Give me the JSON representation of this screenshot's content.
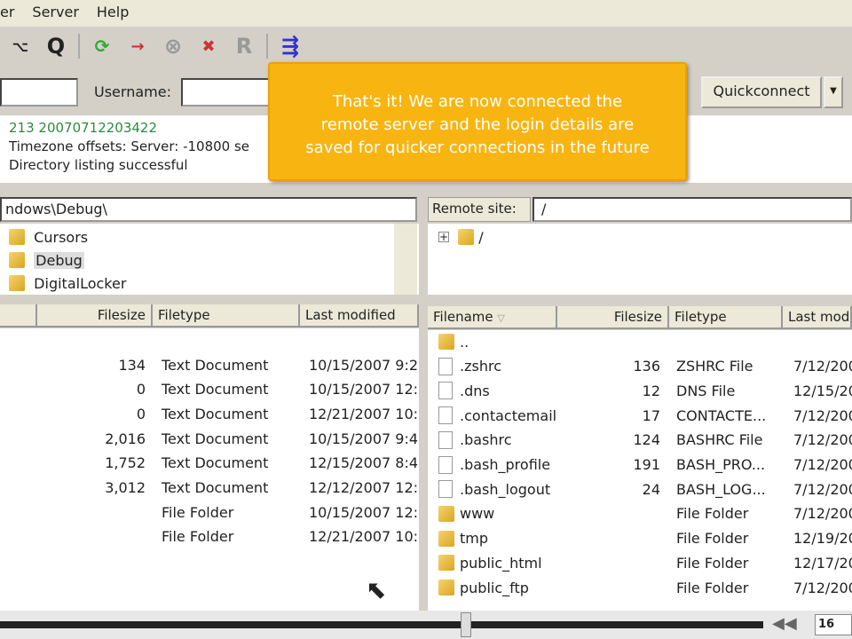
{
  "menu": [
    "er",
    "Server",
    "Help"
  ],
  "quickconnect": {
    "username_label": "Username:",
    "button": "Quickconnect"
  },
  "log": [
    {
      "text": "213 20070712203422",
      "color": "#2e8b3c"
    },
    {
      "text": "Timezone offsets: Server: -10800 se",
      "color": "#222"
    },
    {
      "text": "Directory listing successful",
      "color": "#222"
    }
  ],
  "tooltip": {
    "lines": [
      "That's it!  We are now connected the",
      "remote server and the login details are",
      "saved for quicker connections in the future"
    ]
  },
  "local": {
    "path": "ndows\\Debug\\",
    "tree": [
      "Cursors",
      "Debug",
      "DigitalLocker"
    ],
    "selected_tree": "Debug",
    "columns": [
      "",
      "Filesize",
      "Filetype",
      "Last modified"
    ],
    "rows": [
      [
        "134",
        "Text Document",
        "10/15/2007 9:2"
      ],
      [
        "0",
        "Text Document",
        "10/15/2007 12:"
      ],
      [
        "0",
        "Text Document",
        "12/21/2007 10:"
      ],
      [
        "2,016",
        "Text Document",
        "10/15/2007 9:4"
      ],
      [
        "1,752",
        "Text Document",
        "12/15/2007 8:4"
      ],
      [
        "3,012",
        "Text Document",
        "12/12/2007 12:"
      ],
      [
        "",
        "File Folder",
        "10/15/2007 12:"
      ],
      [
        "",
        "File Folder",
        "12/21/2007 10:"
      ]
    ]
  },
  "remote": {
    "site_label": "Remote site:",
    "path": "/",
    "tree_root": "/",
    "columns": [
      "Filename",
      "Filesize",
      "Filetype",
      "Last mod"
    ],
    "rows": [
      [
        "..",
        "",
        "",
        "",
        "folder"
      ],
      [
        ".zshrc",
        "136",
        "ZSHRC File",
        "7/12/200",
        "file"
      ],
      [
        ".dns",
        "12",
        "DNS File",
        "12/15/20",
        "file"
      ],
      [
        ".contactemail",
        "17",
        "CONTACTE...",
        "7/12/200",
        "file"
      ],
      [
        ".bashrc",
        "124",
        "BASHRC File",
        "7/12/200",
        "file"
      ],
      [
        ".bash_profile",
        "191",
        "BASH_PRO...",
        "7/12/200",
        "file"
      ],
      [
        ".bash_logout",
        "24",
        "BASH_LOG...",
        "7/12/200",
        "file"
      ],
      [
        "www",
        "",
        "File Folder",
        "7/12/200",
        "folder"
      ],
      [
        "tmp",
        "",
        "File Folder",
        "12/19/20",
        "folder"
      ],
      [
        "public_html",
        "",
        "File Folder",
        "12/17/20",
        "folder"
      ],
      [
        "public_ftp",
        "",
        "File Folder",
        "7/12/200",
        "folder"
      ]
    ]
  },
  "player": {
    "progress": 0.61,
    "time": "16"
  }
}
